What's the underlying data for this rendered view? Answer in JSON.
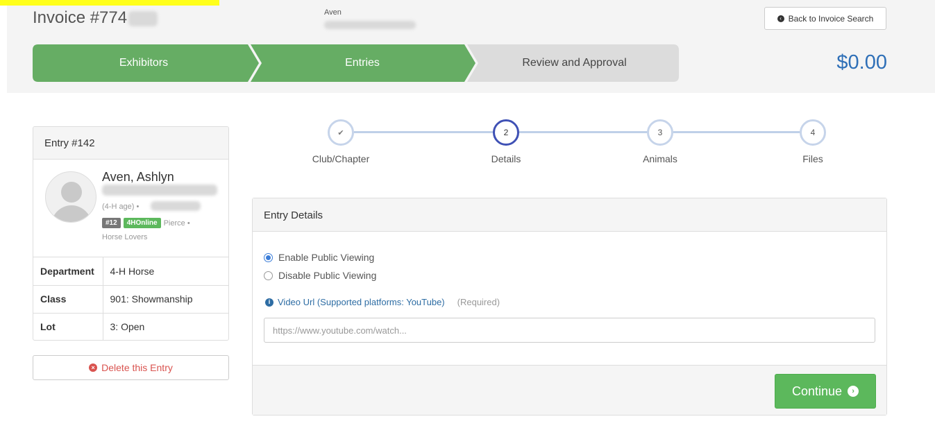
{
  "header": {
    "invoice_title": "Invoice #774",
    "exhibitor_name": "Aven",
    "back_label": "Back to Invoice Search",
    "total": "$0.00"
  },
  "steps": [
    {
      "label": "Exhibitors",
      "state": "complete"
    },
    {
      "label": "Entries",
      "state": "complete"
    },
    {
      "label": "Review and Approval",
      "state": "pending"
    }
  ],
  "colors": {
    "step_complete": "#66ad64",
    "step_pending": "#dcdcdc",
    "accent_blue": "#2e6fb7",
    "danger": "#d9534f",
    "success": "#5cb85c"
  },
  "entry": {
    "title": "Entry #142",
    "name": "Aven, Ashlyn",
    "age_text": "(4-H age) •",
    "tag_number": "#12",
    "tag_source": "4HOnline",
    "county": "Pierce •",
    "club": "Horse Lovers",
    "rows": [
      {
        "key": "Department",
        "value": "4-H Horse"
      },
      {
        "key": "Class",
        "value": "901: Showmanship"
      },
      {
        "key": "Lot",
        "value": "3: Open"
      }
    ],
    "delete_label": "Delete this Entry"
  },
  "wizard": {
    "check_glyph": "✔",
    "steps": [
      {
        "number": "",
        "label": "Club/Chapter",
        "state": "done"
      },
      {
        "number": "2",
        "label": "Details",
        "state": "active"
      },
      {
        "number": "3",
        "label": "Animals",
        "state": "todo"
      },
      {
        "number": "4",
        "label": "Files",
        "state": "todo"
      }
    ]
  },
  "details": {
    "title": "Entry Details",
    "options": [
      {
        "label": "Enable Public Viewing",
        "checked": true
      },
      {
        "label": "Disable Public Viewing",
        "checked": false
      }
    ],
    "video_label": "Video Url (Supported platforms: YouTube)",
    "required_label": "(Required)",
    "url_value": "",
    "url_placeholder": "https://www.youtube.com/watch...",
    "continue_label": "Continue"
  }
}
